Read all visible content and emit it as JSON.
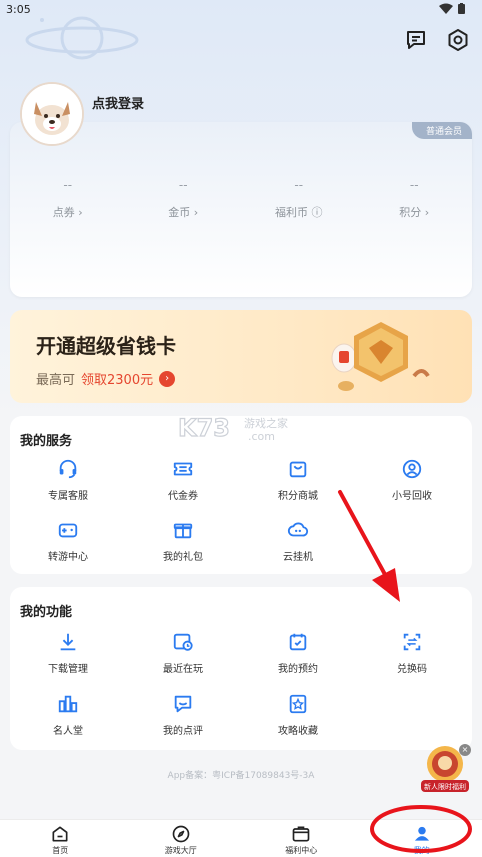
{
  "status_bar": {
    "time": "3:05"
  },
  "profile": {
    "login_text": "点我登录",
    "member_tag": "普通会员",
    "stats": [
      {
        "value": "--",
        "label": "点券 ›"
      },
      {
        "value": "--",
        "label": "金币 ›"
      },
      {
        "value": "--",
        "label": "福利币 ⓘ"
      },
      {
        "value": "--",
        "label": "积分 ›"
      }
    ]
  },
  "promo": {
    "title": "开通超级省钱卡",
    "sub_prefix": "最高可",
    "sub_highlight": "领取2300元",
    "arrow": "›"
  },
  "watermark": "K73 游戏之家 .com",
  "services": {
    "title": "我的服务",
    "items": [
      {
        "label": "专属客服",
        "icon": "headset-icon"
      },
      {
        "label": "代金券",
        "icon": "coupon-icon"
      },
      {
        "label": "积分商城",
        "icon": "shopping-bag-icon"
      },
      {
        "label": "小号回收",
        "icon": "recycle-user-icon"
      },
      {
        "label": "转游中心",
        "icon": "gamepad-transfer-icon"
      },
      {
        "label": "我的礼包",
        "icon": "gift-icon"
      },
      {
        "label": "云挂机",
        "icon": "cloud-game-icon"
      }
    ]
  },
  "functions": {
    "title": "我的功能",
    "items": [
      {
        "label": "下载管理",
        "icon": "download-icon"
      },
      {
        "label": "最近在玩",
        "icon": "recent-play-icon"
      },
      {
        "label": "我的预约",
        "icon": "calendar-check-icon"
      },
      {
        "label": "兑换码",
        "icon": "scan-code-icon"
      },
      {
        "label": "名人堂",
        "icon": "hall-of-fame-icon"
      },
      {
        "label": "我的点评",
        "icon": "comment-icon"
      },
      {
        "label": "攻略收藏",
        "icon": "star-bookmark-icon"
      }
    ]
  },
  "icp": "App备案：粤ICP备17089843号-3A",
  "float_badge": {
    "text": "新人限时福利"
  },
  "tabbar": [
    {
      "label": "首页",
      "icon": "home-icon"
    },
    {
      "label": "游戏大厅",
      "icon": "compass-icon"
    },
    {
      "label": "福利中心",
      "icon": "welfare-icon"
    },
    {
      "label": "我的",
      "icon": "user-icon"
    }
  ],
  "colors": {
    "accent": "#2b7bf0",
    "promo_highlight": "#e5462f",
    "annotation_red": "#e8141b"
  }
}
